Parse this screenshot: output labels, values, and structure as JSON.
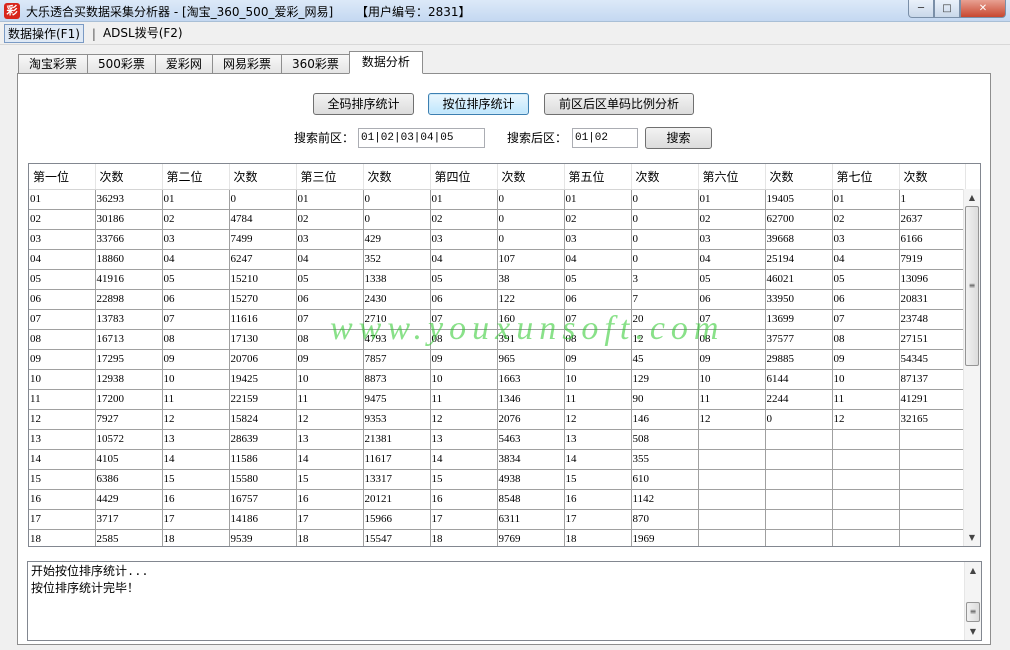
{
  "window": {
    "title": "大乐透合买数据采集分析器 - [淘宝_360_500_爱彩_网易]      【用户编号：2831】",
    "app_icon_glyph": "彩",
    "min_glyph": "─",
    "max_glyph": "□",
    "close_glyph": "✕"
  },
  "menu": {
    "items": [
      {
        "label": "数据操作(F1)"
      },
      {
        "label": "ADSL拨号(F2)"
      }
    ],
    "separator": "|"
  },
  "tabs": [
    "淘宝彩票",
    "500彩票",
    "爱彩网",
    "网易彩票",
    "360彩票",
    "数据分析"
  ],
  "selected_tab": "数据分析",
  "actions": {
    "full_sort": "全码排序统计",
    "position_sort": "按位排序统计",
    "ratio_analysis": "前区后区单码比例分析",
    "search": "搜索"
  },
  "search": {
    "front_label": "搜索前区：",
    "front_value": "01|02|03|04|05",
    "back_label": "搜索后区：",
    "back_value": "01|02"
  },
  "grid": {
    "headers": [
      "第一位",
      "次数",
      "第二位",
      "次数",
      "第三位",
      "次数",
      "第四位",
      "次数",
      "第五位",
      "次数",
      "第六位",
      "次数",
      "第七位",
      "次数"
    ],
    "rows": [
      [
        "01",
        "36293",
        "01",
        "0",
        "01",
        "0",
        "01",
        "0",
        "01",
        "0",
        "01",
        "19405",
        "01",
        "1"
      ],
      [
        "02",
        "30186",
        "02",
        "4784",
        "02",
        "0",
        "02",
        "0",
        "02",
        "0",
        "02",
        "62700",
        "02",
        "2637"
      ],
      [
        "03",
        "33766",
        "03",
        "7499",
        "03",
        "429",
        "03",
        "0",
        "03",
        "0",
        "03",
        "39668",
        "03",
        "6166"
      ],
      [
        "04",
        "18860",
        "04",
        "6247",
        "04",
        "352",
        "04",
        "107",
        "04",
        "0",
        "04",
        "25194",
        "04",
        "7919"
      ],
      [
        "05",
        "41916",
        "05",
        "15210",
        "05",
        "1338",
        "05",
        "38",
        "05",
        "3",
        "05",
        "46021",
        "05",
        "13096"
      ],
      [
        "06",
        "22898",
        "06",
        "15270",
        "06",
        "2430",
        "06",
        "122",
        "06",
        "7",
        "06",
        "33950",
        "06",
        "20831"
      ],
      [
        "07",
        "13783",
        "07",
        "11616",
        "07",
        "2710",
        "07",
        "160",
        "07",
        "20",
        "07",
        "13699",
        "07",
        "23748"
      ],
      [
        "08",
        "16713",
        "08",
        "17130",
        "08",
        "4793",
        "08",
        "391",
        "08",
        "12",
        "08",
        "37577",
        "08",
        "27151"
      ],
      [
        "09",
        "17295",
        "09",
        "20706",
        "09",
        "7857",
        "09",
        "965",
        "09",
        "45",
        "09",
        "29885",
        "09",
        "54345"
      ],
      [
        "10",
        "12938",
        "10",
        "19425",
        "10",
        "8873",
        "10",
        "1663",
        "10",
        "129",
        "10",
        "6144",
        "10",
        "87137"
      ],
      [
        "11",
        "17200",
        "11",
        "22159",
        "11",
        "9475",
        "11",
        "1346",
        "11",
        "90",
        "11",
        "2244",
        "11",
        "41291"
      ],
      [
        "12",
        "7927",
        "12",
        "15824",
        "12",
        "9353",
        "12",
        "2076",
        "12",
        "146",
        "12",
        "0",
        "12",
        "32165"
      ],
      [
        "13",
        "10572",
        "13",
        "28639",
        "13",
        "21381",
        "13",
        "5463",
        "13",
        "508",
        "",
        "",
        "",
        ""
      ],
      [
        "14",
        "4105",
        "14",
        "11586",
        "14",
        "11617",
        "14",
        "3834",
        "14",
        "355",
        "",
        "",
        "",
        ""
      ],
      [
        "15",
        "6386",
        "15",
        "15580",
        "15",
        "13317",
        "15",
        "4938",
        "15",
        "610",
        "",
        "",
        "",
        ""
      ],
      [
        "16",
        "4429",
        "16",
        "16757",
        "16",
        "20121",
        "16",
        "8548",
        "16",
        "1142",
        "",
        "",
        "",
        ""
      ],
      [
        "17",
        "3717",
        "17",
        "14186",
        "17",
        "15966",
        "17",
        "6311",
        "17",
        "870",
        "",
        "",
        "",
        ""
      ],
      [
        "18",
        "2585",
        "18",
        "9539",
        "18",
        "15547",
        "18",
        "9769",
        "18",
        "1969",
        "",
        "",
        "",
        ""
      ]
    ]
  },
  "watermark": "www.youxunsoft.com",
  "log": {
    "lines": [
      "开始按位排序统计...",
      "按位排序统计完毕！"
    ]
  },
  "scroll": {
    "up_glyph": "▲",
    "down_glyph": "▼",
    "grip_glyph": "≡"
  },
  "colors": {
    "watermark": "#28c828",
    "title_bar": "#c4d8f1",
    "focused_button": "#bee6fd"
  }
}
